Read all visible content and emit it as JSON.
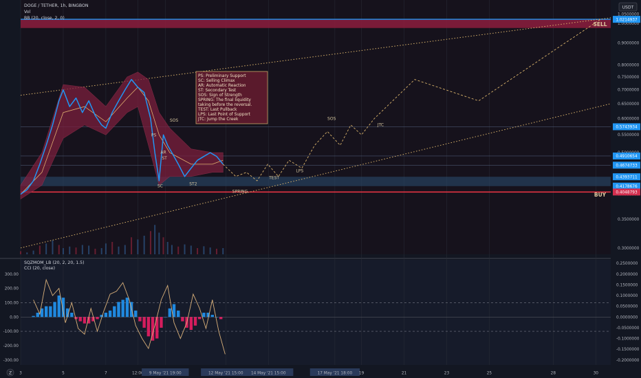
{
  "header": {
    "symbol_line": "DOGE / TETHER, 1h, BINGBON",
    "indicator_vol": "Vol",
    "indicator_bb": "BB (20, close, 2, 0)",
    "currency": "USDT",
    "indicator_sqz": "SQZMOM_LB (20, 2, 20, 1.5)",
    "indicator_cci": "CCI (20, close)",
    "tz_button": "Z"
  },
  "legend": {
    "lines": [
      "PS: Preliminary Support",
      "SC: Selling Climax",
      "AR: Automatic Reaction",
      "ST: Secondary Test",
      "SOS: Sign of Strength",
      "SPRING: The final liquidity",
      "taking before the reversal.",
      "TEST: Last Pullback",
      "LPS: Last Point of Support",
      "JTC: Jump the Creek"
    ]
  },
  "colors": {
    "background": "#131722",
    "price_line": "#2196f3",
    "bb_fill": "#7a1f3d",
    "bb_basis": "#e0b070",
    "sell_zone": "#8c1d3d",
    "support_zone": "#2a4a6a",
    "buy_line": "#f23645",
    "sell_line": "#2196f3",
    "trend_dotted": "#d9b36b",
    "annotation": "#d7c8a0",
    "hist_up": "#2196f3",
    "hist_down": "#e91e63",
    "cci": "#d9b07a"
  },
  "chart_data": [
    {
      "type": "line",
      "pane": "price",
      "y_scale": "log",
      "ylim": [
        0.29,
        1.1
      ],
      "y_ticks": [
        "1.0500000",
        "1.0000000",
        "0.9000000",
        "0.8000000",
        "0.7500000",
        "0.7000000",
        "0.6500000",
        "0.6000000",
        "0.5500000",
        "0.5000000",
        "0.4000000",
        "0.3500000",
        "0.3000000"
      ],
      "y_tick_values": [
        1.05,
        1.0,
        0.9,
        0.8,
        0.75,
        0.7,
        0.65,
        0.6,
        0.55,
        0.5,
        0.4,
        0.35,
        0.3
      ],
      "x_ticks": [
        "3",
        "5",
        "7",
        "12:00",
        "9 May '21  19:00",
        "12 May '21  15:00",
        "14 May '21  15:00",
        "17 May '21  18:00",
        "19",
        "21",
        "23",
        "25",
        "28",
        "30"
      ],
      "x_tick_values": [
        3,
        5,
        7,
        8.5,
        9.79,
        12.63,
        14.63,
        17.75,
        19,
        21,
        23,
        25,
        28,
        30
      ],
      "x_range": [
        3,
        30.7
      ],
      "price_labels": [
        {
          "text": "1.0214937",
          "value": 1.0215,
          "style": "blue"
        },
        {
          "text": "0.5743934",
          "value": 0.5744,
          "style": "blue"
        },
        {
          "text": "0.4910654",
          "value": 0.4911,
          "style": "blue"
        },
        {
          "text": "0.4674733",
          "value": 0.4675,
          "style": "blue"
        },
        {
          "text": "0.4393711",
          "value": 0.4394,
          "style": "blue"
        },
        {
          "text": "0.4178676",
          "value": 0.4179,
          "style": "blue"
        },
        {
          "text": "0.4048793",
          "value": 0.4049,
          "style": "red"
        }
      ],
      "series": [
        {
          "role": "price",
          "x": [
            3,
            3.3,
            3.6,
            3.9,
            4.2,
            4.5,
            4.8,
            5,
            5.3,
            5.6,
            5.9,
            6.2,
            6.5,
            6.8,
            7,
            7.3,
            7.6,
            7.9,
            8.2,
            8.5,
            8.8,
            9.1,
            9.3,
            9.5,
            9.7,
            9.9,
            10.1,
            10.4,
            10.7,
            11.0,
            11.3,
            11.6,
            11.9,
            12.2,
            12.5
          ],
          "y": [
            0.4,
            0.41,
            0.43,
            0.47,
            0.52,
            0.58,
            0.66,
            0.7,
            0.64,
            0.67,
            0.62,
            0.66,
            0.61,
            0.58,
            0.57,
            0.62,
            0.66,
            0.7,
            0.74,
            0.71,
            0.69,
            0.6,
            0.5,
            0.43,
            0.55,
            0.52,
            0.5,
            0.47,
            0.44,
            0.46,
            0.48,
            0.49,
            0.5,
            0.49,
            0.47
          ]
        },
        {
          "role": "bb_upper",
          "x": [
            3,
            4,
            5,
            6,
            7,
            8,
            8.5,
            9,
            9.5,
            10,
            11,
            12,
            12.5
          ],
          "y": [
            0.42,
            0.5,
            0.72,
            0.71,
            0.64,
            0.75,
            0.77,
            0.74,
            0.62,
            0.57,
            0.51,
            0.5,
            0.5
          ]
        },
        {
          "role": "bb_lower",
          "x": [
            3,
            4,
            5,
            6,
            7,
            8,
            8.5,
            9,
            9.5,
            10,
            11,
            12,
            12.5
          ],
          "y": [
            0.39,
            0.42,
            0.54,
            0.58,
            0.55,
            0.62,
            0.64,
            0.52,
            0.42,
            0.44,
            0.44,
            0.45,
            0.45
          ]
        },
        {
          "role": "bb_basis",
          "x": [
            3,
            4,
            5,
            6,
            7,
            8,
            8.5,
            9,
            9.5,
            10,
            11,
            12,
            12.5
          ],
          "y": [
            0.4,
            0.45,
            0.62,
            0.64,
            0.59,
            0.67,
            0.71,
            0.66,
            0.55,
            0.5,
            0.47,
            0.47,
            0.48
          ]
        },
        {
          "role": "projection",
          "x": [
            12.5,
            13.1,
            13.6,
            14.1,
            14.6,
            15.1,
            15.6,
            16.2,
            16.8,
            17.4,
            18,
            18.5,
            19,
            19.6,
            21.5,
            24.5,
            30.2
          ],
          "y": [
            0.47,
            0.44,
            0.45,
            0.43,
            0.47,
            0.44,
            0.48,
            0.46,
            0.52,
            0.56,
            0.52,
            0.58,
            0.55,
            0.6,
            0.74,
            0.66,
            1.02
          ]
        }
      ],
      "trendlines": [
        {
          "x": [
            3,
            30.7
          ],
          "y": [
            0.68,
            1.03
          ]
        },
        {
          "x": [
            3,
            30.7
          ],
          "y": [
            0.3,
            0.65
          ]
        }
      ],
      "zones": [
        {
          "role": "sell",
          "y": [
            0.975,
            1.02
          ]
        },
        {
          "role": "support",
          "y": [
            0.4179,
            0.4394
          ]
        }
      ],
      "levels": [
        {
          "role": "sell",
          "value": 1.0215
        },
        {
          "role": "buy",
          "value": 0.4049
        },
        {
          "role": "guide",
          "value": 0.5744
        },
        {
          "role": "guide",
          "value": 0.4911
        },
        {
          "role": "guide",
          "value": 0.4675
        }
      ],
      "annotations": [
        {
          "text": "SELL",
          "x": 30.2,
          "y": 0.985
        },
        {
          "text": "BUY",
          "x": 30.2,
          "y": 0.395
        },
        {
          "text": "PS",
          "x": 9.25,
          "y": 0.545
        },
        {
          "text": "SOS",
          "x": 10.2,
          "y": 0.59
        },
        {
          "text": "AR",
          "x": 9.7,
          "y": 0.497
        },
        {
          "text": "ST",
          "x": 9.75,
          "y": 0.482
        },
        {
          "text": "SC",
          "x": 9.55,
          "y": 0.415
        },
        {
          "text": "ST2",
          "x": 11.1,
          "y": 0.42
        },
        {
          "text": "SPRING",
          "x": 13.3,
          "y": 0.403
        },
        {
          "text": "TEST",
          "x": 14.9,
          "y": 0.434
        },
        {
          "text": "LPS",
          "x": 16.1,
          "y": 0.45
        },
        {
          "text": "SOS",
          "x": 17.6,
          "y": 0.596
        },
        {
          "text": "JTC",
          "x": 19.9,
          "y": 0.576
        }
      ],
      "volume_pct": [
        0.1,
        0.06,
        0.12,
        0.28,
        0.35,
        0.45,
        0.3,
        0.2,
        0.25,
        0.22,
        0.3,
        0.28,
        0.18,
        0.2,
        0.35,
        0.4,
        0.25,
        0.3,
        0.55,
        0.48,
        0.6,
        0.75,
        0.95,
        0.7,
        0.55,
        0.4,
        0.3,
        0.25,
        0.32,
        0.28,
        0.2,
        0.26,
        0.22,
        0.18,
        0.2
      ]
    },
    {
      "type": "bar",
      "pane": "oscillator",
      "ylim": [
        -0.22,
        0.26
      ],
      "y_ticks": [
        "0.2500000",
        "0.2000000",
        "0.1500000",
        "0.1000000",
        "0.0500000",
        "0.0000000",
        "-0.0500000",
        "-0.1000000",
        "-0.1500000",
        "-0.2000000"
      ],
      "y_tick_values": [
        0.25,
        0.2,
        0.15,
        0.1,
        0.05,
        0.0,
        -0.05,
        -0.1,
        -0.15,
        -0.2
      ],
      "left_ticks": [
        "300.00",
        "200.00",
        "100.00",
        "0.00",
        "-100.00",
        "-200.00",
        "-300.00"
      ],
      "left_tick_values": [
        300,
        200,
        100,
        0,
        -100,
        -200,
        -300
      ],
      "series": [
        {
          "role": "histogram",
          "x": [
            3.6,
            3.8,
            4.0,
            4.2,
            4.4,
            4.6,
            4.8,
            5.0,
            5.2,
            5.4,
            5.6,
            5.8,
            6.0,
            6.2,
            6.4,
            6.6,
            6.8,
            7.0,
            7.2,
            7.4,
            7.6,
            7.8,
            8.0,
            8.2,
            8.4,
            8.6,
            8.8,
            9.0,
            9.2,
            9.4,
            9.6,
            9.8,
            10.0,
            10.2,
            10.4,
            10.6,
            10.8,
            11.0,
            11.2,
            11.4,
            11.6,
            11.8,
            12.0,
            12.2,
            12.4
          ],
          "y": [
            0.005,
            0.02,
            0.04,
            0.05,
            0.05,
            0.07,
            0.1,
            0.09,
            0.04,
            0.02,
            -0.01,
            -0.02,
            -0.03,
            -0.03,
            -0.02,
            -0.01,
            0.01,
            0.02,
            0.03,
            0.05,
            0.07,
            0.08,
            0.09,
            0.07,
            0.03,
            -0.02,
            -0.05,
            -0.09,
            -0.11,
            -0.1,
            -0.05,
            0.0,
            0.04,
            0.06,
            0.03,
            -0.02,
            -0.05,
            -0.06,
            -0.04,
            -0.01,
            0.02,
            0.02,
            0.01,
            0.0,
            -0.01
          ]
        },
        {
          "role": "cci",
          "x": [
            3.6,
            3.9,
            4.2,
            4.5,
            4.8,
            5.1,
            5.4,
            5.7,
            6.0,
            6.3,
            6.6,
            6.9,
            7.2,
            7.5,
            7.8,
            8.1,
            8.4,
            8.7,
            9.0,
            9.3,
            9.6,
            9.9,
            10.2,
            10.5,
            10.8,
            11.1,
            11.4,
            11.7,
            12.0,
            12.3,
            12.6
          ],
          "y": [
            120,
            20,
            260,
            150,
            200,
            -40,
            100,
            -80,
            -120,
            60,
            -100,
            40,
            160,
            180,
            240,
            120,
            -60,
            -150,
            -220,
            -60,
            120,
            220,
            -40,
            -150,
            -40,
            160,
            60,
            -80,
            120,
            -100,
            -260
          ]
        }
      ]
    }
  ]
}
